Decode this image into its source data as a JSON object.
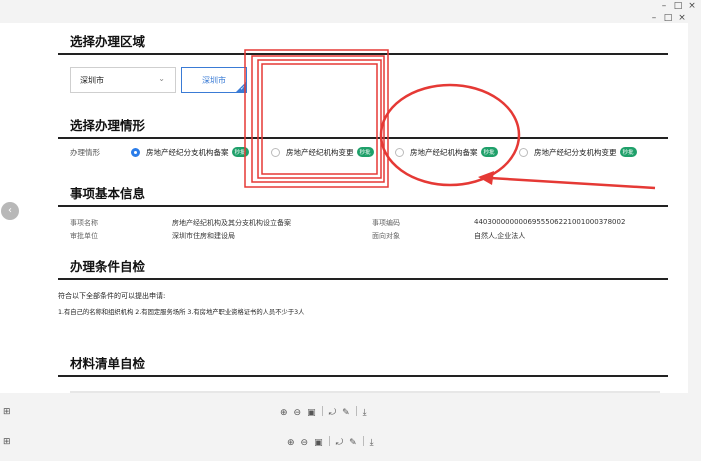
{
  "window": {
    "controls": [
      "–",
      "□",
      "×"
    ]
  },
  "region": {
    "title": "选择办理区域",
    "select_value": "深圳市",
    "selected_tag": "深圳市"
  },
  "situation": {
    "title": "选择办理情形",
    "row_label": "办理情形",
    "options": [
      {
        "label": "房地产经纪分支机构备案",
        "badge": "秒批",
        "checked": true
      },
      {
        "label": "房地产经纪机构变更",
        "badge": "秒批",
        "checked": false
      },
      {
        "label": "房地产经纪机构备案",
        "badge": "秒批",
        "checked": false
      },
      {
        "label": "房地产经纪分支机构变更",
        "badge": "秒批",
        "checked": false
      }
    ]
  },
  "basic_info": {
    "title": "事项基本信息",
    "fields": {
      "item_name_label": "事项名称",
      "item_name_value": "房地产经纪机构及其分支机构设立备案",
      "approval_unit_label": "审批单位",
      "approval_unit_value": "深圳市住房和建设局",
      "item_code_label": "事项编码",
      "item_code_value": "44030000000069555062210010003780​02",
      "target_label": "面向对象",
      "target_value": "自然人,企业法人"
    }
  },
  "conditions": {
    "title": "办理条件自检",
    "intro": "符合以下全部条件的可以提出申请:",
    "items": "1.有自己的名称和组织机构 2.有固定服务场所 3.有房地产职业资格证书的人员不少于3人"
  },
  "materials": {
    "title": "材料清单自检"
  },
  "toolbar": {
    "icons": [
      "zoom-in-icon",
      "zoom-out-icon",
      "fit-page-icon",
      "rotate-icon",
      "edit-icon",
      "download-icon"
    ]
  },
  "colors": {
    "accent": "#2b7de9",
    "badge": "#1fa06a",
    "annotation": "#e53935"
  }
}
